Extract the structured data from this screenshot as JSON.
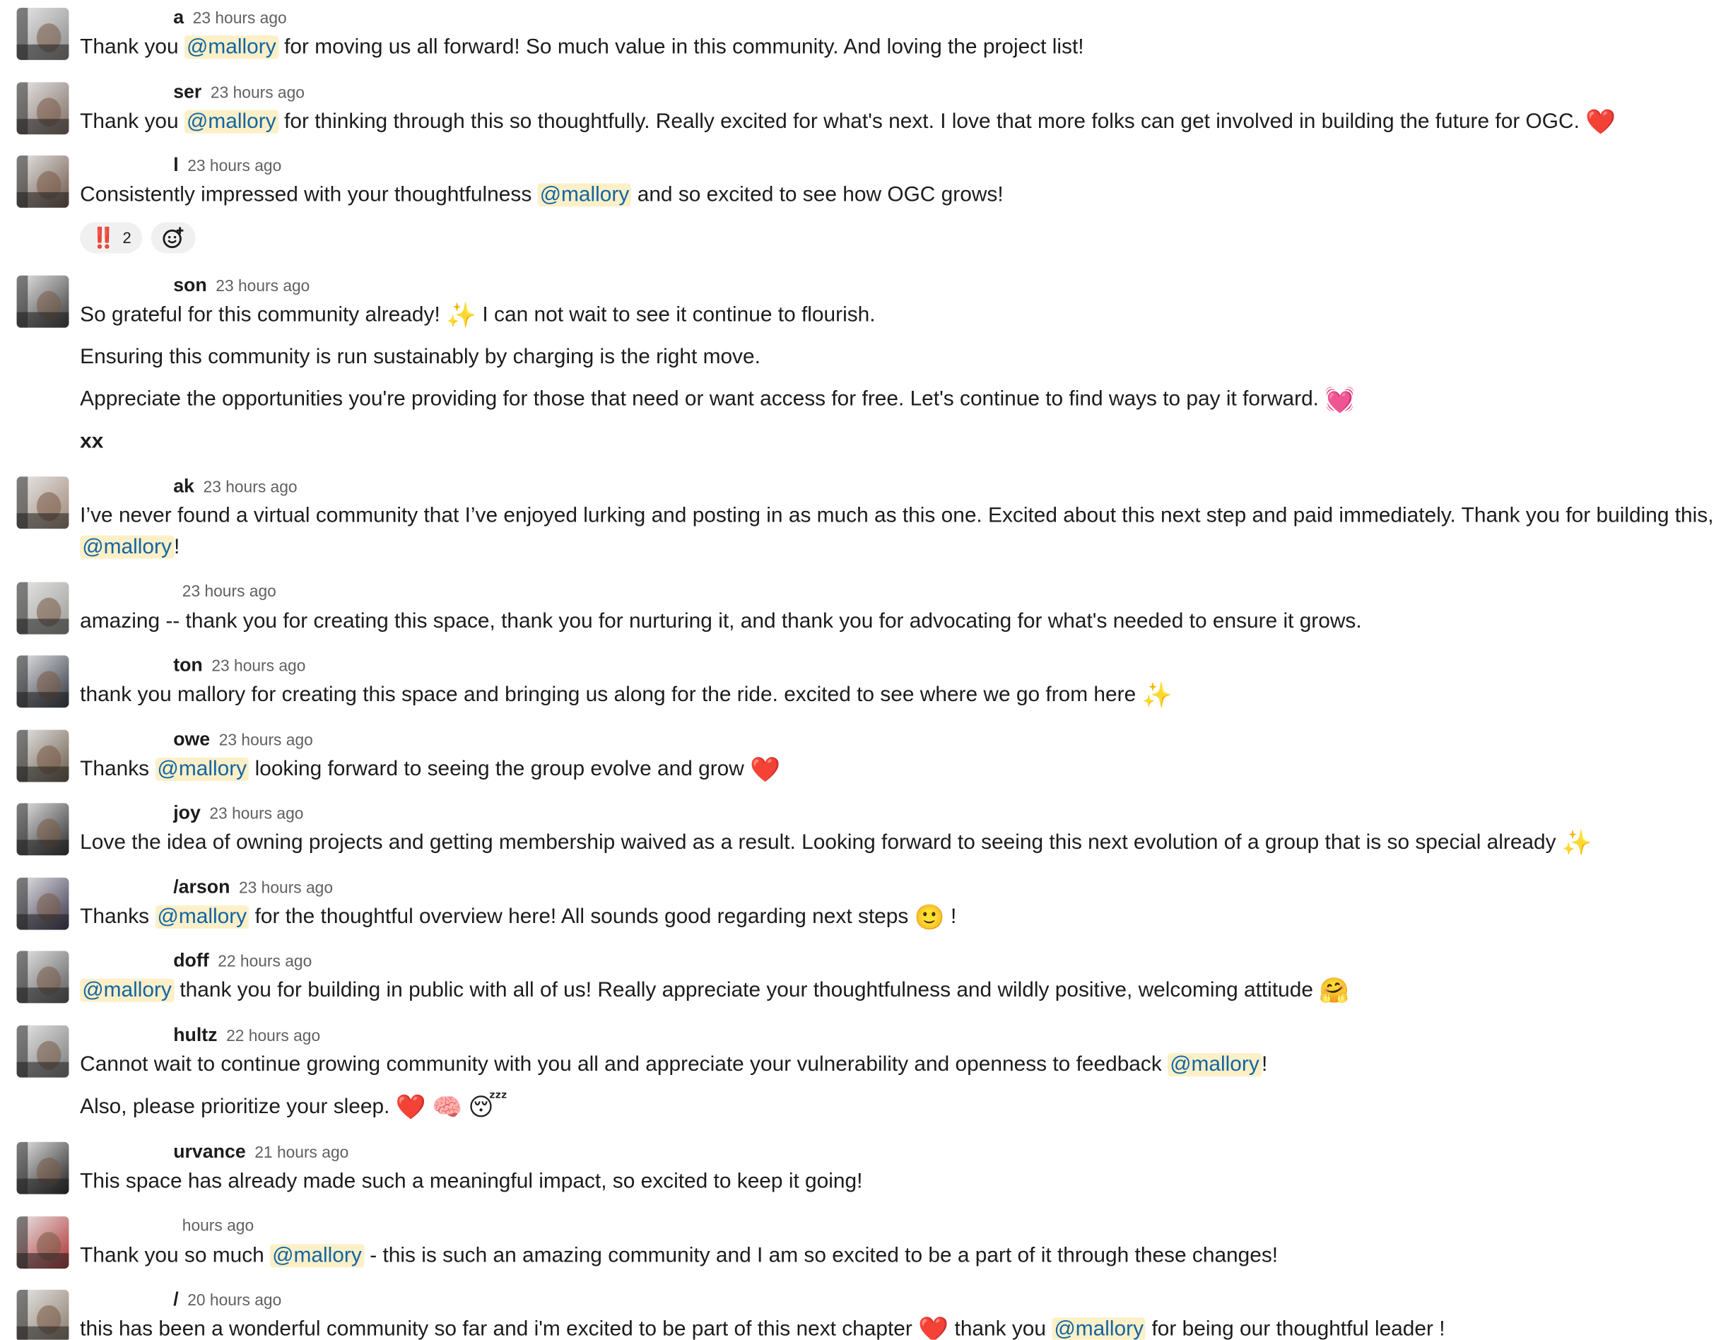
{
  "messages": [
    {
      "name": "a",
      "time": "23 hours ago",
      "avatar": "#8a8a8a",
      "paragraphs": [
        [
          {
            "t": "Thank you "
          },
          {
            "m": "@mallory"
          },
          {
            "t": " for moving us all forward! So much value in this community. And loving the project list!"
          }
        ]
      ]
    },
    {
      "name": "ser",
      "time": "23 hours ago",
      "avatar": "#7d6b62",
      "paragraphs": [
        [
          {
            "t": "Thank you "
          },
          {
            "m": "@mallory"
          },
          {
            "t": " for thinking through this so thoughtfully. Really excited for what's next. I love that more folks can get involved in building the future for OGC. "
          },
          {
            "e": "❤️",
            "n": "heart-emoji"
          }
        ]
      ]
    },
    {
      "name": "l",
      "time": "23 hours ago",
      "avatar": "#6d5548",
      "paragraphs": [
        [
          {
            "t": "Consistently impressed with your thoughtfulness "
          },
          {
            "m": "@mallory"
          },
          {
            "t": " and so excited to see how OGC grows!"
          }
        ]
      ],
      "reactions": [
        {
          "emoji": "‼️",
          "count": "2"
        }
      ]
    },
    {
      "name": "son",
      "time": "23 hours ago",
      "avatar": "#3a3a3a",
      "paragraphs": [
        [
          {
            "t": "So grateful for this community already! "
          },
          {
            "e": "✨",
            "n": "sparkles-emoji"
          },
          {
            "t": " I can not wait to see it continue to flourish."
          }
        ],
        [
          {
            "t": "Ensuring this community is run sustainably by charging is the right move."
          }
        ],
        [
          {
            "t": "Appreciate the opportunities you're providing for those that need or want access for free. Let's continue to find ways to pay it forward. "
          },
          {
            "e": "💓",
            "n": "beating-heart-emoji"
          }
        ],
        [
          {
            "b": "xx"
          }
        ]
      ]
    },
    {
      "name": "ak",
      "time": "23 hours ago",
      "avatar": "#a08878",
      "paragraphs": [
        [
          {
            "t": "I’ve never found a virtual community that I’ve enjoyed lurking and posting in as much as this one. Excited about this next step and paid immediately. Thank you for building this, "
          },
          {
            "m": "@mallory"
          },
          {
            "t": "!"
          }
        ]
      ]
    },
    {
      "name": "",
      "time": "23 hours ago",
      "avatar": "#9a9a96",
      "paragraphs": [
        [
          {
            "t": "amazing -- thank you for creating this space, thank you for nurturing it, and thank you for advocating for what's needed to ensure it grows."
          }
        ]
      ]
    },
    {
      "name": "ton",
      "time": "23 hours ago",
      "avatar": "#2e3440",
      "paragraphs": [
        [
          {
            "t": "thank you mallory for creating this space and bringing us along for the ride. excited to see where we go from here "
          },
          {
            "e": "✨",
            "n": "sparkles-emoji"
          }
        ]
      ]
    },
    {
      "name": "owe",
      "time": "23 hours ago",
      "avatar": "#6a5a48",
      "paragraphs": [
        [
          {
            "t": "Thanks "
          },
          {
            "m": "@mallory"
          },
          {
            "t": " looking forward to seeing the group evolve and grow "
          },
          {
            "e": "❤️",
            "n": "heart-emoji"
          }
        ]
      ]
    },
    {
      "name": "joy",
      "time": "23 hours ago",
      "avatar": "#2a2a2a",
      "paragraphs": [
        [
          {
            "t": "Love the idea of owning projects and getting membership waived as a result. Looking forward to seeing this next evolution of a group that is so special already "
          },
          {
            "e": "✨",
            "n": "sparkles-emoji"
          }
        ]
      ]
    },
    {
      "name": "/arson",
      "time": "23 hours ago",
      "avatar": "#3a3550",
      "paragraphs": [
        [
          {
            "t": "Thanks "
          },
          {
            "m": "@mallory"
          },
          {
            "t": " for the thoughtful overview here! All sounds good regarding next steps "
          },
          {
            "e": "🙂",
            "n": "slightly-smiling-emoji"
          },
          {
            "t": " !"
          }
        ]
      ]
    },
    {
      "name": "doff",
      "time": "22 hours ago",
      "avatar": "#5a5a5a",
      "paragraphs": [
        [
          {
            "m": "@mallory"
          },
          {
            "t": " thank you for building in public with all of us! Really appreciate your thoughtfulness and wildly positive, welcoming attitude "
          },
          {
            "e": "🤗",
            "n": "hugging-face-emoji"
          }
        ]
      ]
    },
    {
      "name": "hultz",
      "time": "22 hours ago",
      "avatar": "#7a7a7a",
      "paragraphs": [
        [
          {
            "t": "Cannot wait to continue growing community with you all and appreciate your vulnerability and openness to feedback "
          },
          {
            "m": "@mallory"
          },
          {
            "t": "!"
          }
        ],
        [
          {
            "t": "Also, please prioritize your sleep. "
          },
          {
            "e": "❤️",
            "n": "heart-emoji"
          },
          {
            "t": " "
          },
          {
            "e": "🧠",
            "n": "brain-emoji"
          },
          {
            "t": " "
          },
          {
            "e": "😴",
            "n": "sleeping-face-emoji"
          }
        ]
      ]
    },
    {
      "name": "urvance",
      "time": "21 hours ago",
      "avatar": "#1e1e1e",
      "paragraphs": [
        [
          {
            "t": "This space has already made such a meaningful impact, so excited to keep it going!"
          }
        ]
      ]
    },
    {
      "name": "",
      "time": "hours ago",
      "avatar": "#b03030",
      "paragraphs": [
        [
          {
            "t": "Thank you so much "
          },
          {
            "m": "@mallory"
          },
          {
            "t": " - this is such an amazing community and I am so excited to be a part of it through these changes!"
          }
        ]
      ]
    },
    {
      "name": "/",
      "time": "20 hours ago",
      "avatar": "#8a7a6a",
      "paragraphs": [
        [
          {
            "t": "this has been a wonderful community so far and i'm excited to be part of this next chapter "
          },
          {
            "e": "❤️",
            "n": "heart-emoji"
          },
          {
            "t": " thank you "
          },
          {
            "m": "@mallory"
          },
          {
            "t": " for being our thoughtful leader !"
          }
        ]
      ]
    }
  ]
}
